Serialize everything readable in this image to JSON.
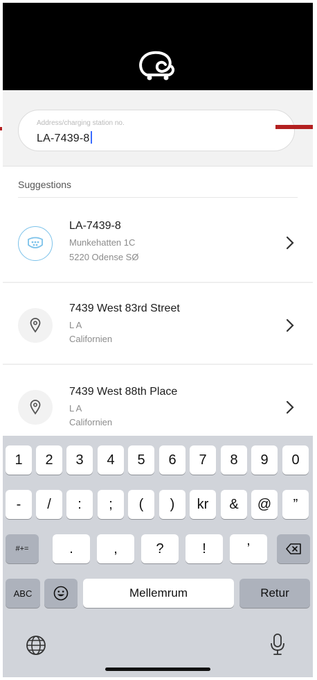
{
  "search": {
    "placeholder": "Address/charging station no.",
    "value": "LA-7439-8"
  },
  "suggestions": {
    "header": "Suggestions",
    "items": [
      {
        "title": "LA-7439-8",
        "line1": "Munkehatten 1C",
        "line2": "5220 Odense SØ",
        "icon": "charging-station-icon"
      },
      {
        "title": "7439 West 83rd Street",
        "line1": "L A",
        "line2": "Californien",
        "icon": "location-pin-icon"
      },
      {
        "title": "7439 West 88th Place",
        "line1": "L A",
        "line2": "Californien",
        "icon": "location-pin-icon"
      }
    ]
  },
  "keyboard": {
    "row1": [
      "1",
      "2",
      "3",
      "4",
      "5",
      "6",
      "7",
      "8",
      "9",
      "0"
    ],
    "row2": [
      "-",
      "/",
      ":",
      ";",
      "(",
      ")",
      "kr",
      "&",
      "@",
      "”"
    ],
    "symbols_toggle": "#+=",
    "row3": [
      ".",
      ",",
      "?",
      "!",
      "’"
    ],
    "abc": "ABC",
    "space": "Mellemrum",
    "return": "Retur"
  },
  "colors": {
    "header_bg": "#000000",
    "accent_station": "#7cc2ea",
    "caret": "#3b6cff",
    "annotation_arrow": "#b32020"
  }
}
